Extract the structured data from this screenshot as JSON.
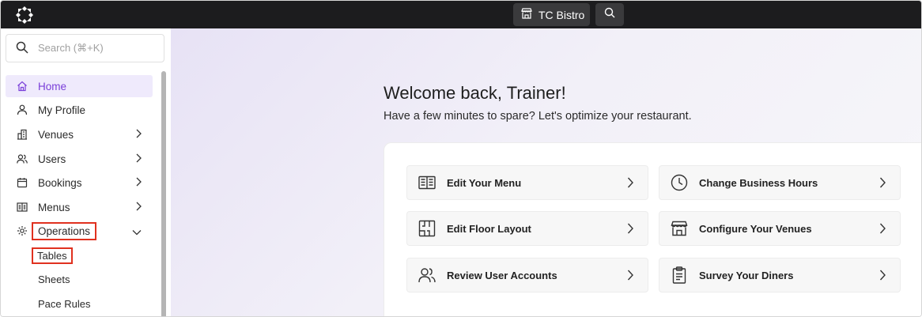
{
  "topbar": {
    "venue_label": "TC Bistro"
  },
  "sidebar": {
    "search_placeholder": "Search (⌘+K)",
    "items": [
      {
        "label": "Home",
        "icon": "home-icon"
      },
      {
        "label": "My Profile",
        "icon": "user-icon"
      },
      {
        "label": "Venues",
        "icon": "building-icon"
      },
      {
        "label": "Users",
        "icon": "users-icon"
      },
      {
        "label": "Bookings",
        "icon": "calendar-icon"
      },
      {
        "label": "Menus",
        "icon": "menu-book-icon"
      },
      {
        "label": "Operations",
        "icon": "gear-icon"
      }
    ],
    "sub_items": [
      "Tables",
      "Sheets",
      "Pace Rules"
    ]
  },
  "main": {
    "welcome": "Welcome back, Trainer!",
    "subtitle": "Have a few minutes to spare? Let's optimize your restaurant.",
    "actions": [
      {
        "label": "Edit Your Menu",
        "icon": "menu-book-icon"
      },
      {
        "label": "Change Business Hours",
        "icon": "clock-icon"
      },
      {
        "label": "Edit Floor Layout",
        "icon": "floor-plan-icon"
      },
      {
        "label": "Configure Your Venues",
        "icon": "storefront-icon"
      },
      {
        "label": "Review User Accounts",
        "icon": "users-icon"
      },
      {
        "label": "Survey Your Diners",
        "icon": "clipboard-icon"
      }
    ]
  },
  "colors": {
    "accent": "#7a3fd9",
    "active_bg": "#efeafc",
    "highlight": "#e0311f",
    "topbar_bg": "#1c1c1e"
  }
}
